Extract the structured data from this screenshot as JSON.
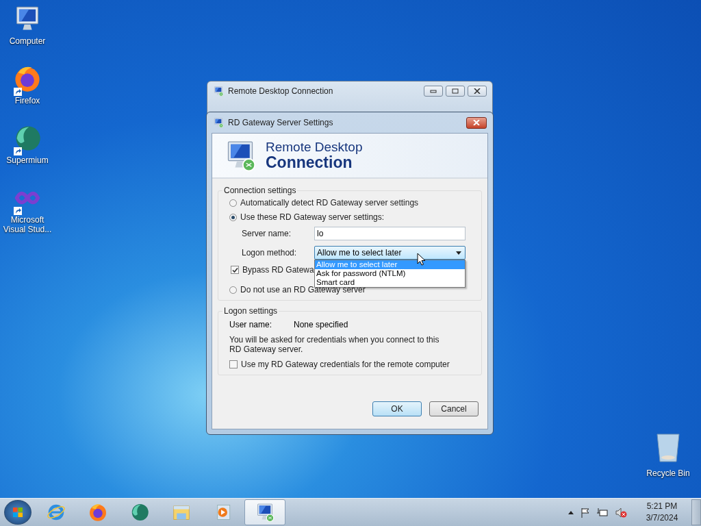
{
  "desktop_icons": [
    {
      "label": "Computer",
      "kind": "computer",
      "shortcut": false
    },
    {
      "label": "Firefox",
      "kind": "firefox",
      "shortcut": true
    },
    {
      "label": "Supermium",
      "kind": "supermium",
      "shortcut": true
    },
    {
      "label": "Microsoft Visual Stud...",
      "kind": "vstudio",
      "shortcut": true
    }
  ],
  "recycle_bin": {
    "label": "Recycle Bin"
  },
  "background_window": {
    "title": "Remote Desktop Connection"
  },
  "dialog": {
    "title": "RD Gateway Server Settings",
    "banner": {
      "line_1": "Remote Desktop",
      "line_2": "Connection"
    },
    "connection_settings": {
      "legend": "Connection settings",
      "options": [
        {
          "label": "Automatically detect RD Gateway server settings",
          "selected": false
        },
        {
          "label": "Use these RD Gateway server settings:",
          "selected": true
        },
        {
          "label": "Do not use an RD Gateway server",
          "selected": false
        }
      ],
      "server_name": {
        "label": "Server name:",
        "value": "lo"
      },
      "logon_method": {
        "label": "Logon method:",
        "value": "Allow me to select later",
        "expanded": true,
        "options": [
          {
            "label": "Allow me to select later",
            "selected": true
          },
          {
            "label": "Ask for password (NTLM)",
            "selected": false
          },
          {
            "label": "Smart card",
            "selected": false
          }
        ]
      },
      "bypass": {
        "label": "Bypass RD Gatewa",
        "checked": true
      }
    },
    "logon_settings": {
      "legend": "Logon settings",
      "user_name_label": "User name:",
      "user_name_value": "None specified",
      "note": "You will be asked for credentials when you connect to this RD Gateway server.",
      "use_credentials": {
        "label": "Use my RD Gateway credentials for the remote computer",
        "checked": false
      }
    },
    "buttons": [
      {
        "label": "OK",
        "default": true
      },
      {
        "label": "Cancel",
        "default": false
      }
    ]
  },
  "taskbar": {
    "items": [
      {
        "kind": "ie",
        "selected": false
      },
      {
        "kind": "firefox",
        "selected": false
      },
      {
        "kind": "supermium",
        "selected": false
      },
      {
        "kind": "explorer",
        "selected": false
      },
      {
        "kind": "media",
        "selected": false
      },
      {
        "kind": "rdc",
        "selected": true
      }
    ],
    "clock": {
      "time": "5:21 PM",
      "date": "3/7/2024"
    }
  }
}
